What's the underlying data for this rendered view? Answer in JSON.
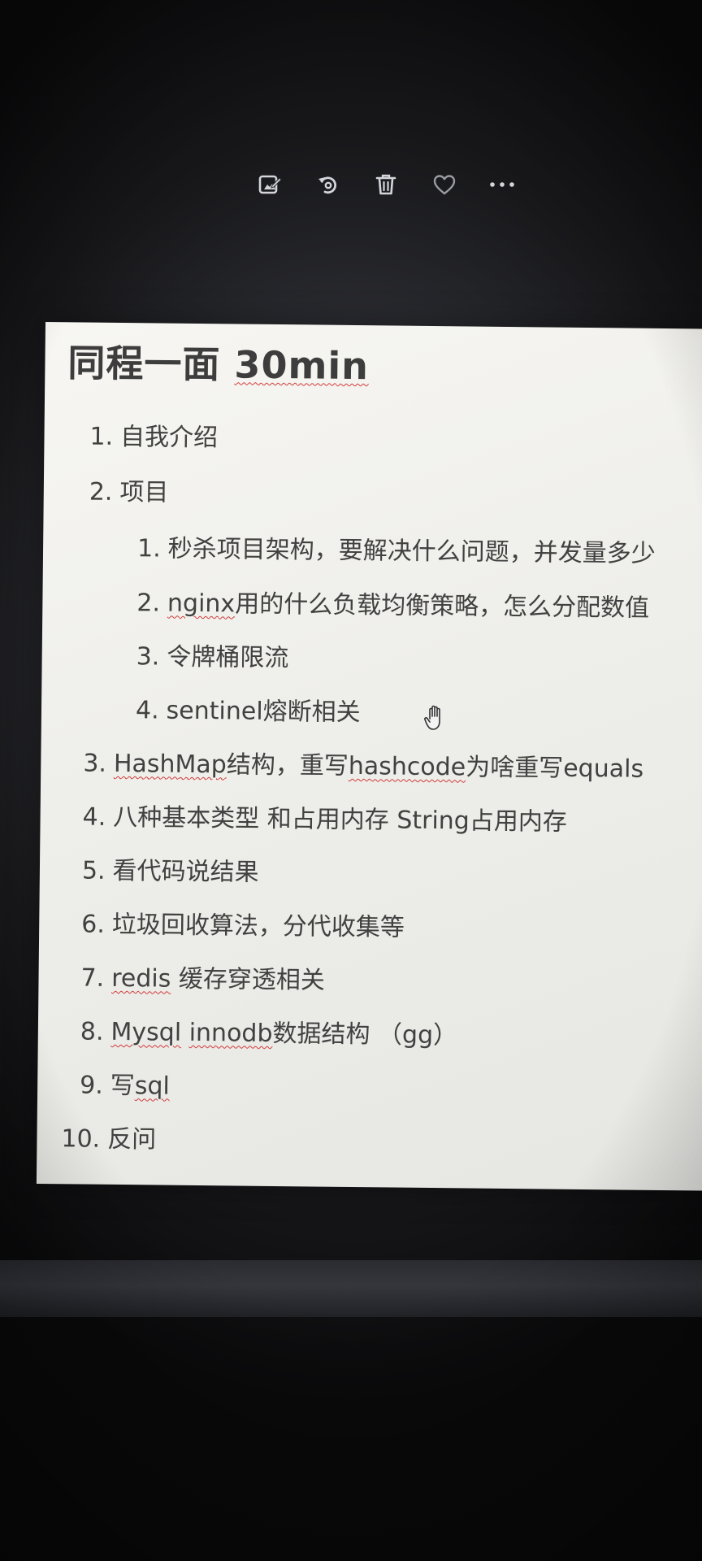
{
  "toolbar": {
    "icons": [
      "edit-image-icon",
      "rotate-icon",
      "trash-icon",
      "heart-icon",
      "more-icon"
    ]
  },
  "note": {
    "title_cn": "同程一面 ",
    "title_en": "30min",
    "items": [
      {
        "num": "1.",
        "text": "自我介绍"
      },
      {
        "num": "2.",
        "text": "项目"
      },
      {
        "num": "1.",
        "text": "秒杀项目架构，要解决什么问题，并发量多少"
      },
      {
        "num": "2.",
        "spell": "nginx",
        "rest": "用的什么负载均衡策略，怎么分配数值"
      },
      {
        "num": "3.",
        "text": "令牌桶限流"
      },
      {
        "num": "4.",
        "text": "sentinel熔断相关"
      },
      {
        "num": "3.",
        "spell": "HashMap",
        "mid": "结构，重写",
        "spell2": "hashcode",
        "rest": "为啥重写equals"
      },
      {
        "num": "4.",
        "text": "八种基本类型 和占用内存  String占用内存"
      },
      {
        "num": "5.",
        "text": "看代码说结果"
      },
      {
        "num": "6.",
        "text": "垃圾回收算法，分代收集等"
      },
      {
        "num": "7.",
        "spell": "redis",
        "rest": " 缓存穿透相关"
      },
      {
        "num": "8.",
        "spell": "Mysql",
        "mid": " ",
        "spell2": "innodb",
        "rest": "数据结构 （gg）"
      },
      {
        "num": "9.",
        "text": "写",
        "spell": "sql"
      },
      {
        "num": "10.",
        "text": "反问"
      }
    ]
  }
}
